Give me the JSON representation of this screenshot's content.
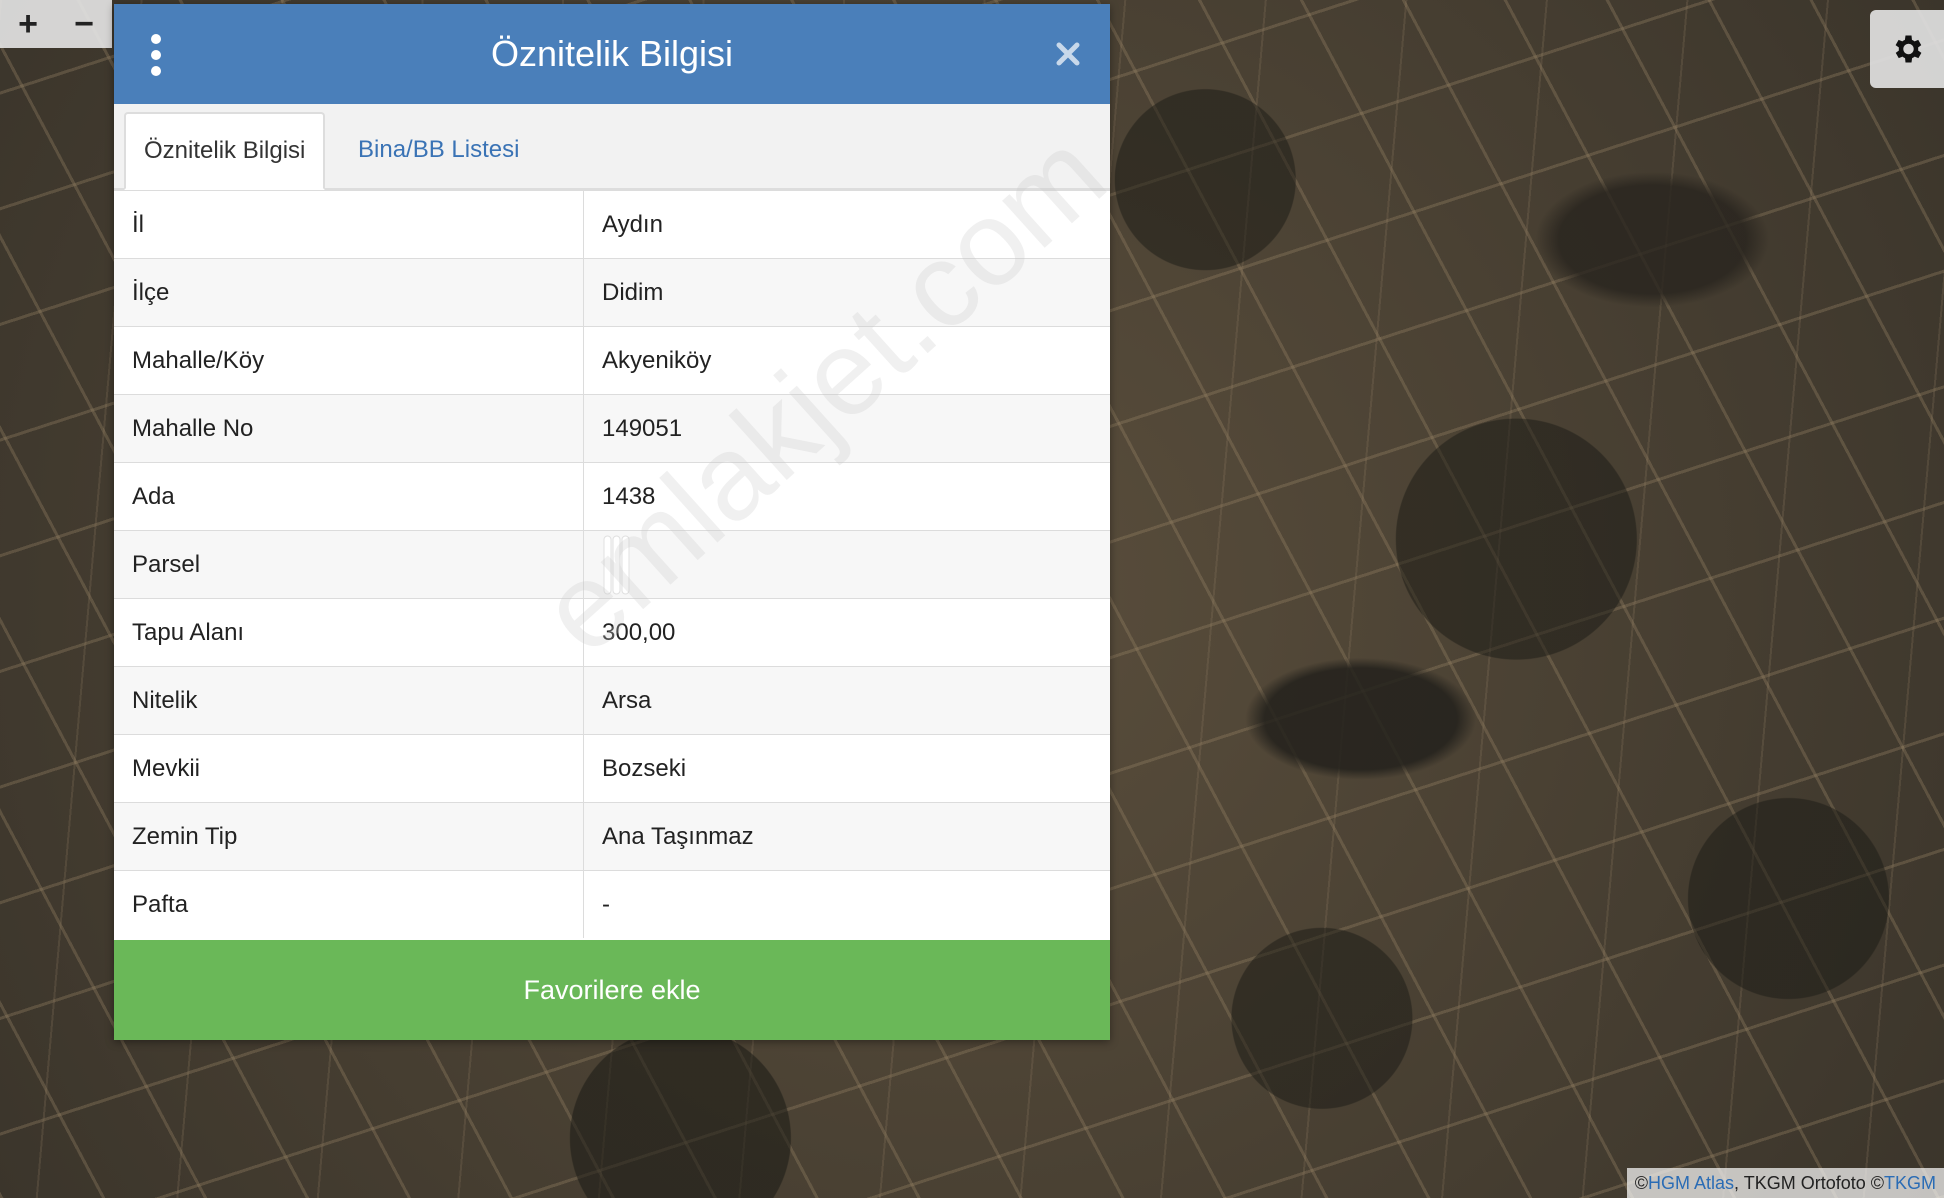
{
  "map": {
    "zoom_in_label": "+",
    "zoom_out_label": "−",
    "settings_icon": "gear-icon"
  },
  "panel": {
    "title": "Öznitelik Bilgisi",
    "menu_icon": "kebab-menu-icon",
    "close_icon": "close-icon",
    "tabs": [
      {
        "label": "Öznitelik Bilgisi",
        "active": true
      },
      {
        "label": "Bina/BB Listesi",
        "active": false
      }
    ],
    "rows": [
      {
        "key": "İl",
        "value": "Aydın"
      },
      {
        "key": "İlçe",
        "value": "Didim"
      },
      {
        "key": "Mahalle/Köy",
        "value": "Akyeniköy"
      },
      {
        "key": "Mahalle No",
        "value": "149051"
      },
      {
        "key": "Ada",
        "value": "1438"
      },
      {
        "key": "Parsel",
        "value": ""
      },
      {
        "key": "Tapu Alanı",
        "value": "300,00"
      },
      {
        "key": "Nitelik",
        "value": "Arsa"
      },
      {
        "key": "Mevkii",
        "value": "Bozseki"
      },
      {
        "key": "Zemin Tip",
        "value": "Ana Taşınmaz"
      },
      {
        "key": "Pafta",
        "value": "-"
      }
    ],
    "favorite_button": "Favorilere ekle"
  },
  "watermark": "emlakjet.com",
  "attribution": {
    "prefix": "© ",
    "link1": "HGM Atlas",
    "middle": ", TKGM Ortofoto © ",
    "link2": "TKGM"
  },
  "colors": {
    "header": "#4a7fba",
    "favorite": "#6ab858",
    "tab_link": "#3a73b5"
  }
}
